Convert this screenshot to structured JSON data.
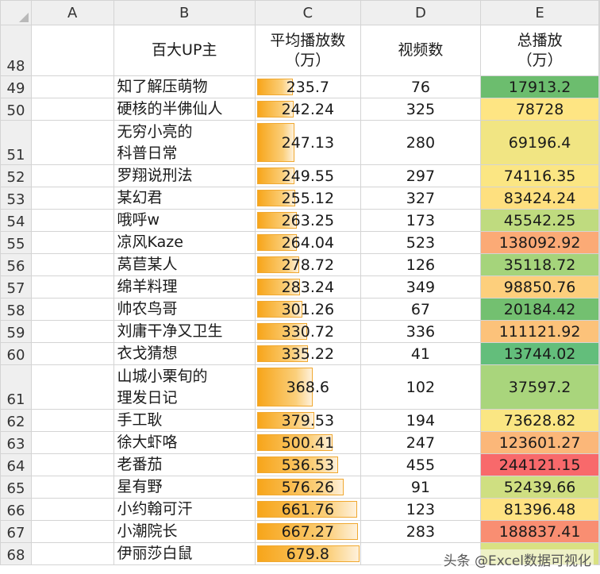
{
  "columns": [
    "A",
    "B",
    "C",
    "D",
    "E"
  ],
  "header_row": {
    "row_num": "48",
    "b": "百大UP主",
    "c_line1": "平均播放数",
    "c_line2": "（万）",
    "d": "视频数",
    "e_line1": "总播放",
    "e_line2": "（万）"
  },
  "rows": [
    {
      "num": "49",
      "name": "知了解压萌物",
      "avg": "235.7",
      "avg_level": 0.347,
      "videos": "76",
      "total": "17913.2",
      "color": "#6cbd6e"
    },
    {
      "num": "50",
      "name": "硬核的半佛仙人",
      "avg": "242.24",
      "avg_level": 0.356,
      "videos": "325",
      "total": "78728",
      "color": "#fee583"
    },
    {
      "num": "51",
      "name": "无穷小亮的科普日常",
      "name_l1": "无穷小亮的",
      "name_l2": "科普日常",
      "avg": "247.13",
      "avg_level": 0.363,
      "videos": "280",
      "total": "69196.4",
      "color": "#f1e583"
    },
    {
      "num": "52",
      "name": "罗翔说刑法",
      "avg": "249.55",
      "avg_level": 0.367,
      "videos": "297",
      "total": "74116.35",
      "color": "#fbe683"
    },
    {
      "num": "53",
      "name": "某幻君",
      "avg": "255.12",
      "avg_level": 0.375,
      "videos": "327",
      "total": "83424.24",
      "color": "#fee07f"
    },
    {
      "num": "54",
      "name": "哦呼w",
      "avg": "263.25",
      "avg_level": 0.387,
      "videos": "173",
      "total": "45542.25",
      "color": "#bfdb7f"
    },
    {
      "num": "55",
      "name": "凉风Kaze",
      "avg": "264.04",
      "avg_level": 0.388,
      "videos": "523",
      "total": "138092.92",
      "color": "#fbaa76"
    },
    {
      "num": "56",
      "name": "莴苣某人",
      "avg": "278.72",
      "avg_level": 0.41,
      "videos": "126",
      "total": "35118.72",
      "color": "#a5d47b"
    },
    {
      "num": "57",
      "name": "绵羊料理",
      "avg": "283.24",
      "avg_level": 0.417,
      "videos": "349",
      "total": "98850.76",
      "color": "#fdcf7c"
    },
    {
      "num": "58",
      "name": "帅农鸟哥",
      "avg": "301.26",
      "avg_level": 0.443,
      "videos": "67",
      "total": "20184.42",
      "color": "#73c070"
    },
    {
      "num": "59",
      "name": "刘庸干净又卫生",
      "avg": "330.72",
      "avg_level": 0.486,
      "videos": "336",
      "total": "111121.92",
      "color": "#fcc27a"
    },
    {
      "num": "60",
      "name": "衣戈猜想",
      "avg": "335.22",
      "avg_level": 0.493,
      "videos": "41",
      "total": "13744.02",
      "color": "#63be7b"
    },
    {
      "num": "61",
      "name": "山城小栗旬的理发日记",
      "name_l1": "山城小栗旬的",
      "name_l2": "理发日记",
      "avg": "368.6",
      "avg_level": 0.542,
      "videos": "102",
      "total": "37597.2",
      "color": "#a9d57c"
    },
    {
      "num": "62",
      "name": "手工耿",
      "avg": "379.53",
      "avg_level": 0.558,
      "videos": "194",
      "total": "73628.82",
      "color": "#fae683"
    },
    {
      "num": "63",
      "name": "徐大虾咯",
      "avg": "500.41",
      "avg_level": 0.736,
      "videos": "247",
      "total": "123601.27",
      "color": "#fbb779"
    },
    {
      "num": "64",
      "name": "老番茄",
      "avg": "536.53",
      "avg_level": 0.789,
      "videos": "455",
      "total": "244121.15",
      "color": "#f8696b"
    },
    {
      "num": "65",
      "name": "星有野",
      "avg": "576.26",
      "avg_level": 0.847,
      "videos": "91",
      "total": "52439.66",
      "color": "#cfdf81"
    },
    {
      "num": "66",
      "name": "小约翰可汗",
      "avg": "661.76",
      "avg_level": 0.973,
      "videos": "123",
      "total": "81396.48",
      "color": "#fee282"
    },
    {
      "num": "67",
      "name": "小潮院长",
      "avg": "667.27",
      "avg_level": 0.981,
      "videos": "283",
      "total": "188837.41",
      "color": "#f98e72"
    },
    {
      "num": "68",
      "name": "伊丽莎白鼠",
      "avg": "679.8",
      "avg_level": 1.0,
      "videos": "",
      "total": "",
      "color": "#d9e182"
    }
  ],
  "watermark": "头条 @Excel数据可视化"
}
